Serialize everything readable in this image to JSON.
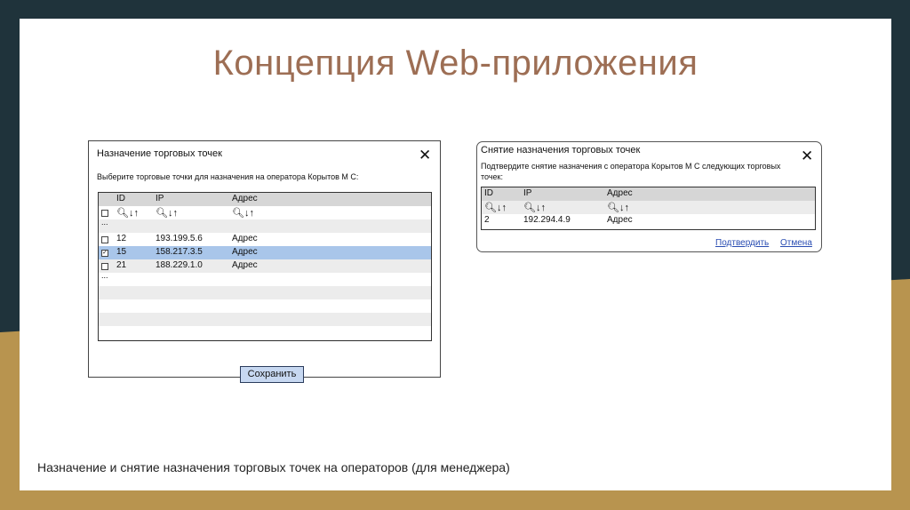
{
  "slide": {
    "title": "Концепция Web-приложения",
    "caption": "Назначение и снятие назначения торговых точек на операторов (для менеджера)"
  },
  "assign_dialog": {
    "title": "Назначение торговых точек",
    "subtitle": "Выберите торговые точки для назначения на оператора Корытов М С:",
    "close_glyph": "✕",
    "columns": [
      "ID",
      "IP",
      "Адрес"
    ],
    "tool_glyphs": "🔍︎↓↑",
    "ellipsis": "...",
    "rows": [
      {
        "id": "12",
        "ip": "193.199.5.6",
        "address": "Адрес",
        "checked": false,
        "selected": false
      },
      {
        "id": "15",
        "ip": "158.217.3.5",
        "address": "Адрес",
        "checked": true,
        "selected": true
      },
      {
        "id": "21",
        "ip": "188.229.1.0",
        "address": "Адрес",
        "checked": false,
        "selected": false
      }
    ],
    "save_label": "Сохранить",
    "selection_color": "#a9c6ea"
  },
  "unassign_dialog": {
    "title": "Снятие назначения торговых точек",
    "subtitle": "Подтвердите снятие назначения с оператора Корытов М С следующих торговых точек:",
    "close_glyph": "✕",
    "columns": [
      "ID",
      "IP",
      "Адрес"
    ],
    "rows": [
      {
        "id": "2",
        "ip": "192.294.4.9",
        "address": "Адрес"
      }
    ],
    "confirm_label": "Подтвердить",
    "cancel_label": "Отмена"
  }
}
